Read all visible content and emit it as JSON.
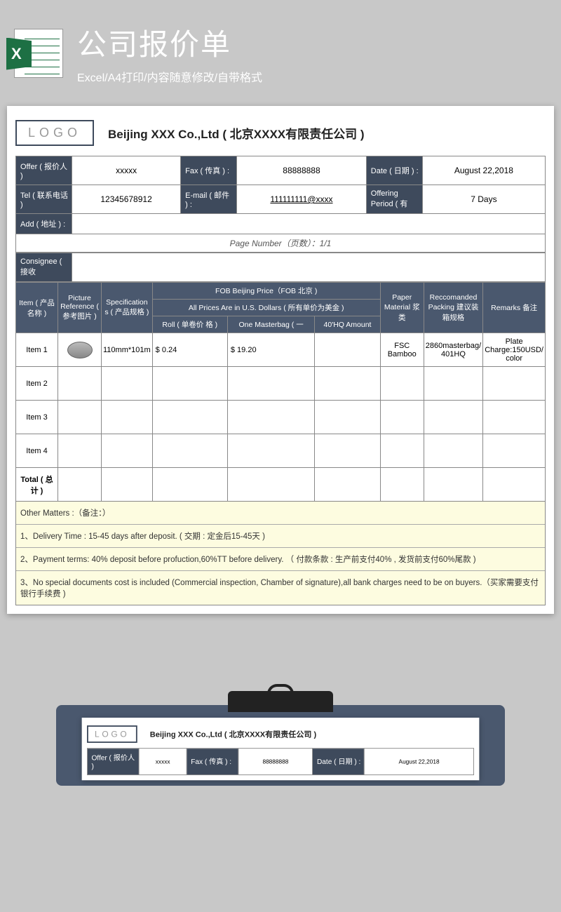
{
  "header": {
    "title": "公司报价单",
    "subtitle": "Excel/A4打印/内容随意修改/自带格式"
  },
  "doc": {
    "logo": "LOGO",
    "company": "Beijing XXX Co.,Ltd ( 北京XXXX有限责任公司 )",
    "info": {
      "offer_lbl": "Offer ( 报价人 )",
      "offer_val": "xxxxx",
      "fax_lbl": "Fax ( 传真 ) :",
      "fax_val": "88888888",
      "date_lbl": "Date ( 日期 ) :",
      "date_val": "August 22,2018",
      "tel_lbl": "Tel ( 联系电话 )",
      "tel_val": "12345678912",
      "email_lbl": "E-mail ( 邮件 ) :",
      "email_val": "111111111@xxxx",
      "period_lbl": "Offering Period ( 有",
      "period_val": "7 Days",
      "add_lbl": "Add ( 地址 ) :",
      "add_val": "",
      "pagenum": "Page Number（页数）：1/1",
      "consignee_lbl": "Consignee ( 接收",
      "consignee_val": ""
    },
    "thead": {
      "item": "Item\n( 产品名称 )",
      "pic": "Picture\nReference\n( 参考图片 )",
      "spec": "Specification\ns\n( 产品规格 )",
      "fob_top": "FOB Beijing Price（FOB 北京 )",
      "fob_sub": "All Prices Are in U.S. Dollars ( 所有单价为美金 )",
      "roll": "Roll ( 单卷价\n格 )",
      "one": "One\nMasterbag ( 一",
      "hq": "40'HQ\nAmount",
      "paper": "Paper\nMaterial\n浆类",
      "pack": "Reccomanded\nPacking\n建议装箱规格",
      "remarks": "Remarks\n备注"
    },
    "rows": [
      {
        "item": "Item 1",
        "pic": true,
        "spec": "110mm*101m",
        "roll": "$        0.24",
        "one": "$       19.20",
        "hq": "",
        "paper": "FSC Bamboo",
        "pack": "2860masterbag/\n401HQ",
        "remarks": "Plate\nCharge:150USD/\ncolor"
      },
      {
        "item": "Item 2",
        "pic": false,
        "spec": "",
        "roll": "",
        "one": "",
        "hq": "",
        "paper": "",
        "pack": "",
        "remarks": ""
      },
      {
        "item": "Item 3",
        "pic": false,
        "spec": "",
        "roll": "",
        "one": "",
        "hq": "",
        "paper": "",
        "pack": "",
        "remarks": ""
      },
      {
        "item": "Item 4",
        "pic": false,
        "spec": "",
        "roll": "",
        "one": "",
        "hq": "",
        "paper": "",
        "pack": "",
        "remarks": ""
      }
    ],
    "total_lbl": "Total ( 总计 )",
    "notes": {
      "title": "Other Matters :（备注：）",
      "n1": "1、Delivery Time : 15-45 days after deposit. ( 交期 : 定金后15-45天 )",
      "n2": "2、Payment terms: 40% deposit before profuction,60%TT before delivery. （ 付款条款 : 生产前支付40% , 发货前支付60%尾款 )",
      "n3": "3、No special documents cost is included (Commercial inspection, Chamber of signature),all bank charges need to be on buyers.（买家需要支付银行手续费 )"
    }
  }
}
